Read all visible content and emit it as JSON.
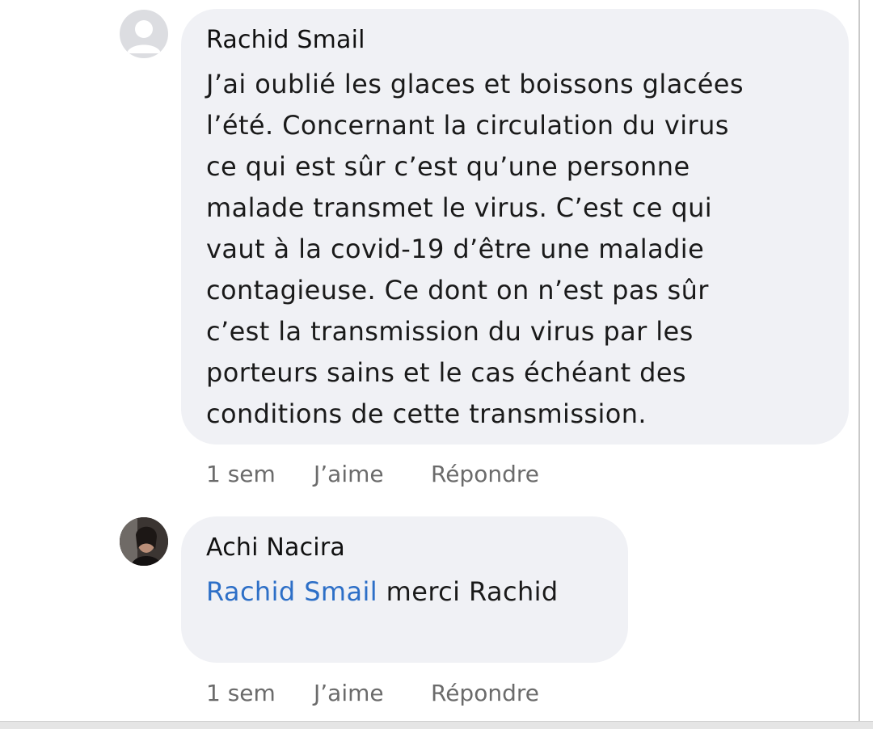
{
  "comments": [
    {
      "author": "Rachid Smail",
      "avatar": "default-avatar-icon",
      "lines": [
        "J’ai oublié les glaces et boissons glacées",
        "l’été. Concernant la circulation du virus",
        "ce qui est sûr c’est qu’une personne",
        "malade transmet le virus. C’est ce qui",
        "vaut à la covid-19 d’être une maladie",
        "contagieuse. Ce dont on n’est pas sûr",
        "c’est la transmission du virus par les",
        "porteurs sains et le cas échéant des",
        "conditions de cette transmission."
      ],
      "time": "1 sem",
      "like_label": "J’aime",
      "reply_label": "Répondre"
    },
    {
      "author": "Achi Nacira",
      "avatar": "profile-photo",
      "mention": "Rachid Smail",
      "text": "merci Rachid",
      "time": "1 sem",
      "like_label": "J’aime",
      "reply_label": "Répondre"
    }
  ],
  "colors": {
    "bubble": "#f0f1f5",
    "mention": "#2d6fc7",
    "meta": "#6b6b6b"
  }
}
